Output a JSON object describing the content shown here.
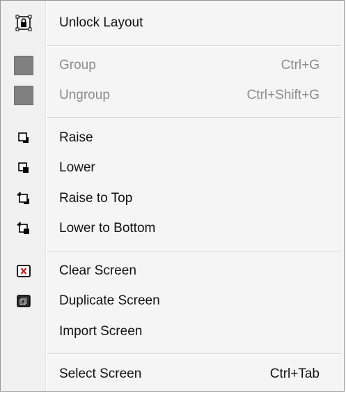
{
  "menu": {
    "items": [
      {
        "label": "Unlock Layout",
        "shortcut": "",
        "icon": "unlock-layout-icon",
        "enabled": true
      },
      {
        "label": "Group",
        "shortcut": "Ctrl+G",
        "icon": "group-placeholder-icon",
        "enabled": false
      },
      {
        "label": "Ungroup",
        "shortcut": "Ctrl+Shift+G",
        "icon": "ungroup-placeholder-icon",
        "enabled": false
      },
      {
        "label": "Raise",
        "shortcut": "",
        "icon": "raise-icon",
        "enabled": true
      },
      {
        "label": "Lower",
        "shortcut": "",
        "icon": "lower-icon",
        "enabled": true
      },
      {
        "label": "Raise to Top",
        "shortcut": "",
        "icon": "raise-to-top-icon",
        "enabled": true
      },
      {
        "label": "Lower to Bottom",
        "shortcut": "",
        "icon": "lower-to-bottom-icon",
        "enabled": true
      },
      {
        "label": "Clear Screen",
        "shortcut": "",
        "icon": "clear-screen-icon",
        "enabled": true
      },
      {
        "label": "Duplicate Screen",
        "shortcut": "",
        "icon": "duplicate-screen-icon",
        "enabled": true
      },
      {
        "label": "Import Screen",
        "shortcut": "",
        "icon": "",
        "enabled": true
      },
      {
        "label": "Select Screen",
        "shortcut": "Ctrl+Tab",
        "icon": "",
        "enabled": true
      }
    ]
  },
  "colors": {
    "text": "#111111",
    "disabled_text": "#8d8d8d",
    "clear_icon_red": "#cc1a1a"
  }
}
